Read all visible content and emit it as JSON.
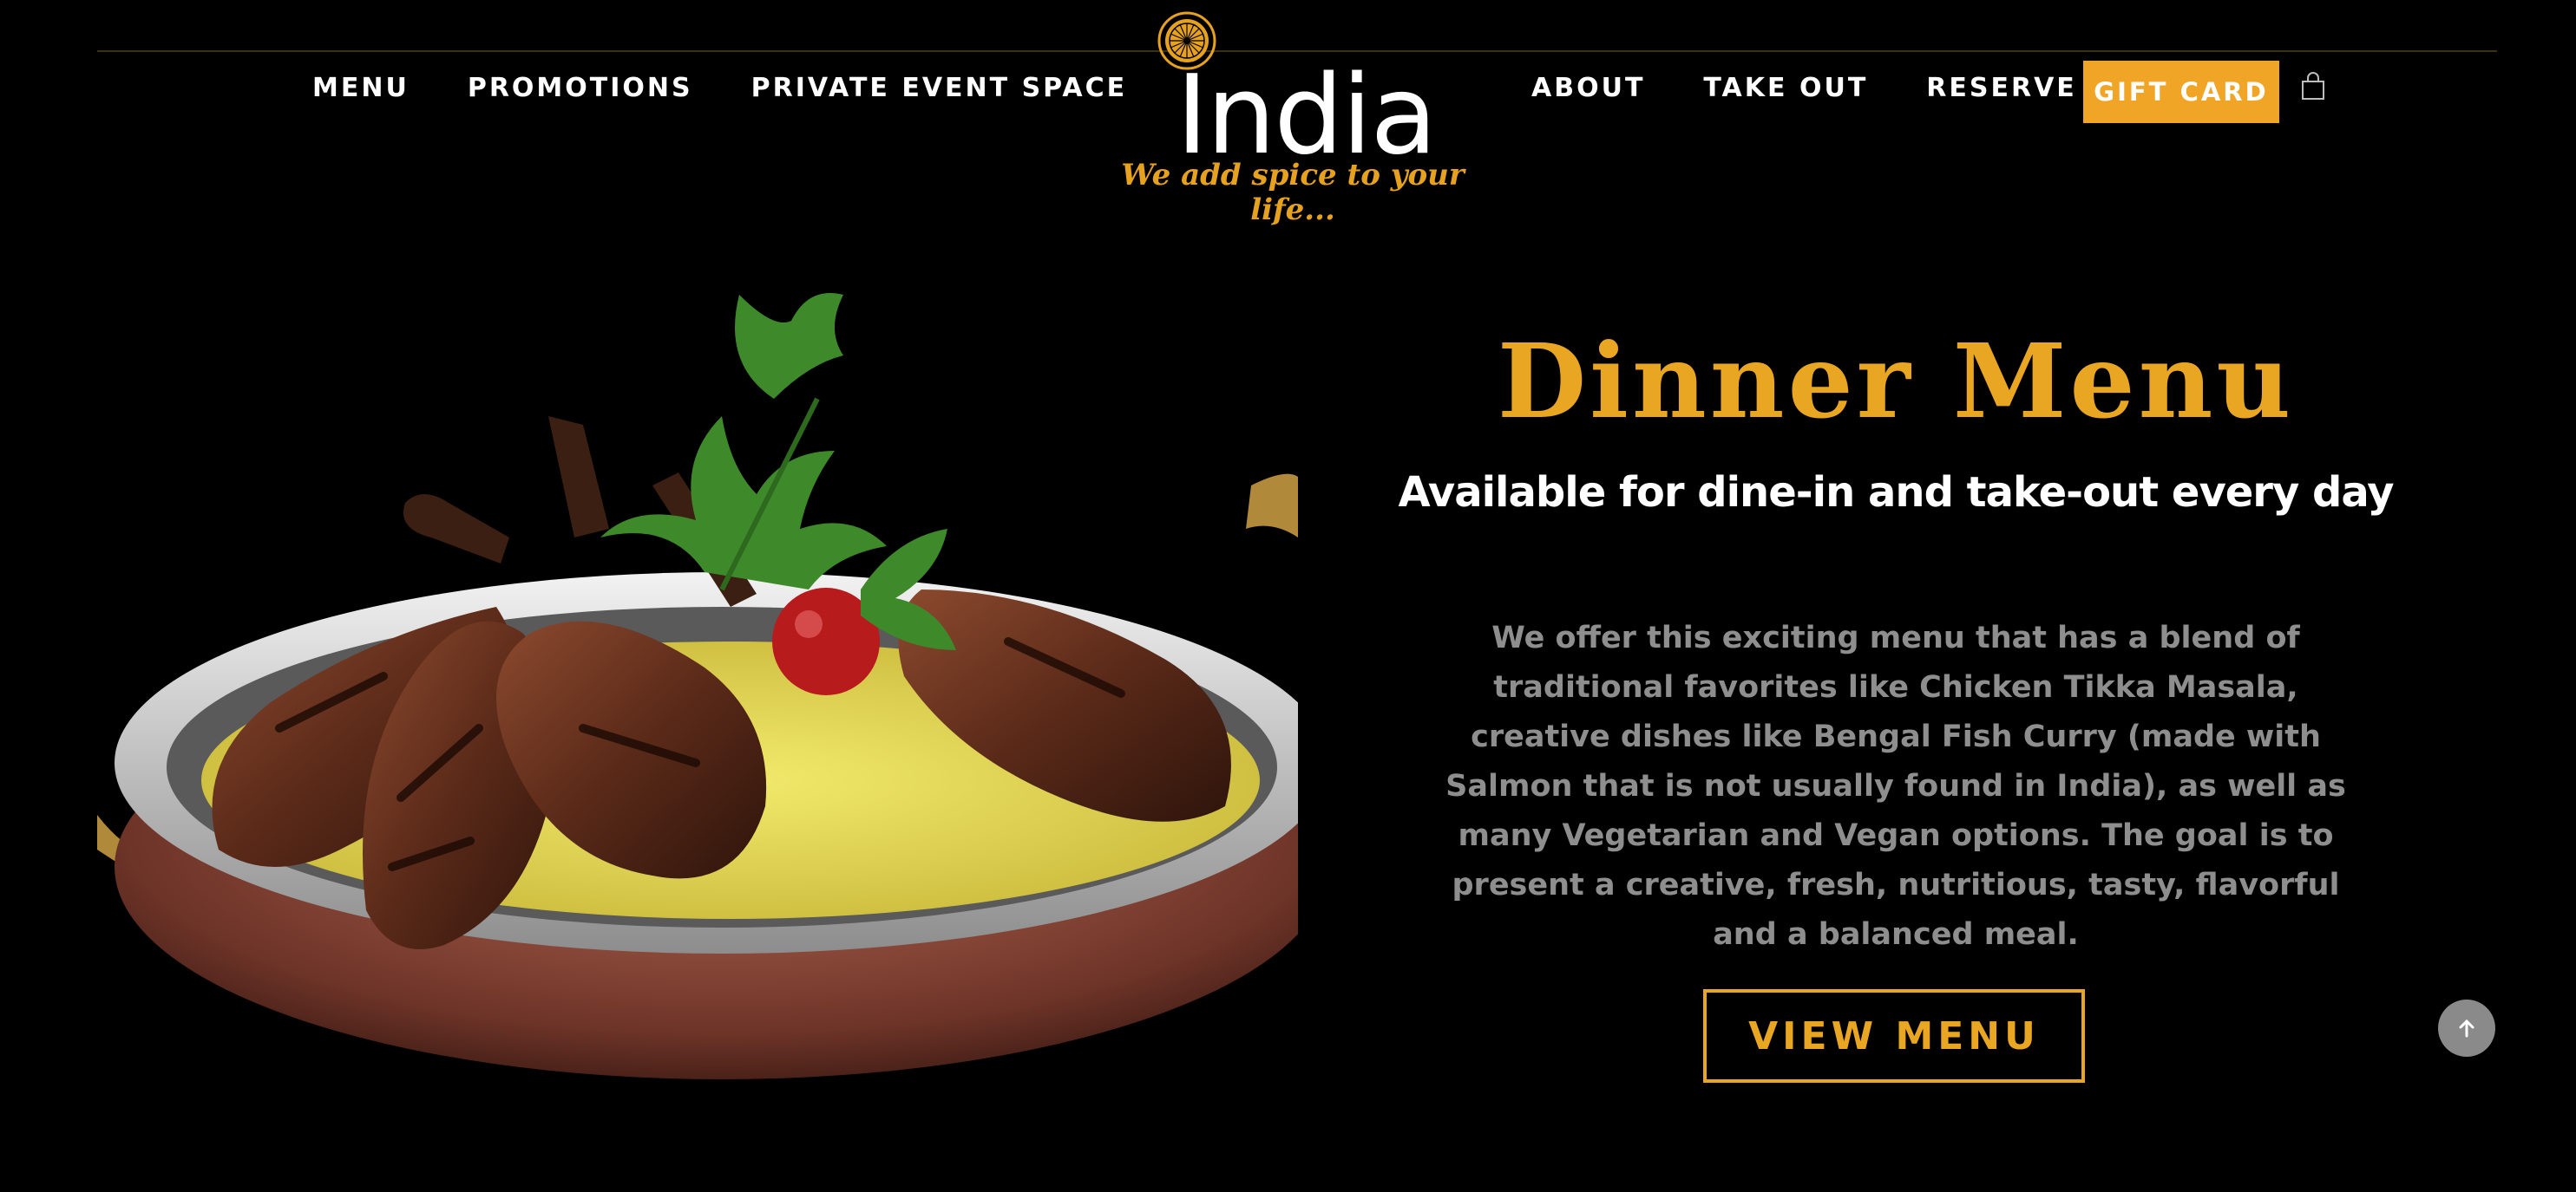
{
  "nav": {
    "left": [
      "MENU",
      "PROMOTIONS",
      "PRIVATE EVENT SPACE"
    ],
    "right": [
      "ABOUT",
      "TAKE OUT",
      "RESERVE"
    ],
    "gift_card": "GIFT CARD",
    "cart_icon": "shopping-bag-icon"
  },
  "logo": {
    "emblem_icon": "ashoka-wheel-icon",
    "wordmark": "India",
    "tagline": "We add spice to your life..."
  },
  "hero": {
    "image": "lamb-chops-biryani-photo",
    "title": "Dinner Menu",
    "subtitle": "Available for dine-in and take-out every day",
    "description": "We offer this exciting menu that has a blend of traditional favorites like Chicken Tikka Masala, creative dishes like Bengal Fish Curry (made with Salmon that is not usually found in India), as well as many Vegetarian and Vegan options. The goal is to present a creative, fresh, nutritious, tasty, flavorful and a balanced meal.",
    "cta": "VIEW MENU"
  },
  "scroll_top_icon": "arrow-up-icon",
  "colors": {
    "accent": "#f0a526",
    "background": "#000000",
    "muted_text": "#8e8e8e"
  }
}
